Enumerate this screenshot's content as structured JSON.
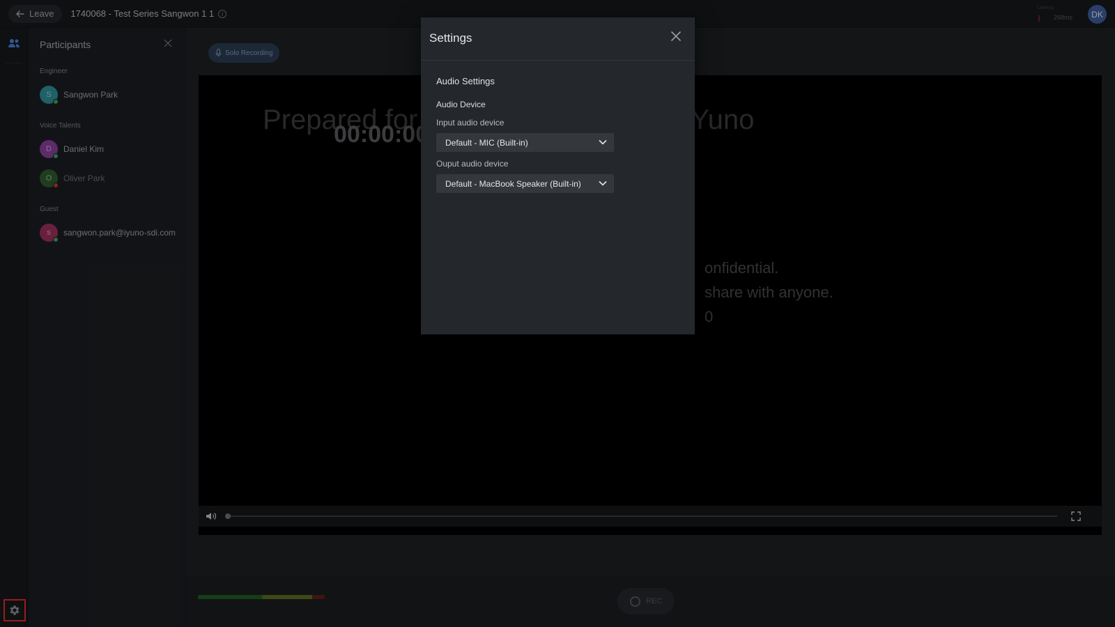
{
  "topbar": {
    "leave_label": "Leave",
    "session_title": "1740068 - Test Series Sangwon 1 1",
    "latency_label": "Latency",
    "latency_value": "268ms",
    "user_initials": "DK"
  },
  "participants": {
    "title": "Participants",
    "groups": [
      {
        "label": "Engineer",
        "people": [
          {
            "initial": "S",
            "name": "Sangwon Park",
            "avatar_color": "#2f8f9a",
            "status_color": "#3fa35c"
          }
        ]
      },
      {
        "label": "Voice Talents",
        "people": [
          {
            "initial": "D",
            "name": "Daniel Kim",
            "avatar_color": "#8a3f9c",
            "status_color": "#3fa35c"
          },
          {
            "initial": "O",
            "name": "Oliver Park",
            "avatar_color": "#2e5a2e",
            "status_color": "#c0392b"
          }
        ]
      },
      {
        "label": "Guest",
        "people": [
          {
            "initial": "s",
            "name": "sangwon.park@iyuno-sdi.com",
            "avatar_color": "#9c2f5e",
            "status_color": "#3fa35c"
          }
        ]
      }
    ]
  },
  "stage": {
    "solo_recording_label": "Solo Recording",
    "watermark_text": "Prepared for 4@Iyunomg.com at i-Yuno",
    "timecode": "00:00:00",
    "notice_line1": "onfidential.",
    "notice_line2": "share with anyone.",
    "notice_line3": "0",
    "rec_label": "REC"
  },
  "settings_modal": {
    "title": "Settings",
    "section_title": "Audio Settings",
    "device_title": "Audio Device",
    "input_label": "Input audio device",
    "input_value": "Default - MIC (Built-in)",
    "output_label": "Ouput audio device",
    "output_value": "Default - MacBook Speaker (Built-in)"
  },
  "colors": {
    "accent_blue": "#3d5e9c",
    "highlight_red": "#e22b2b"
  }
}
